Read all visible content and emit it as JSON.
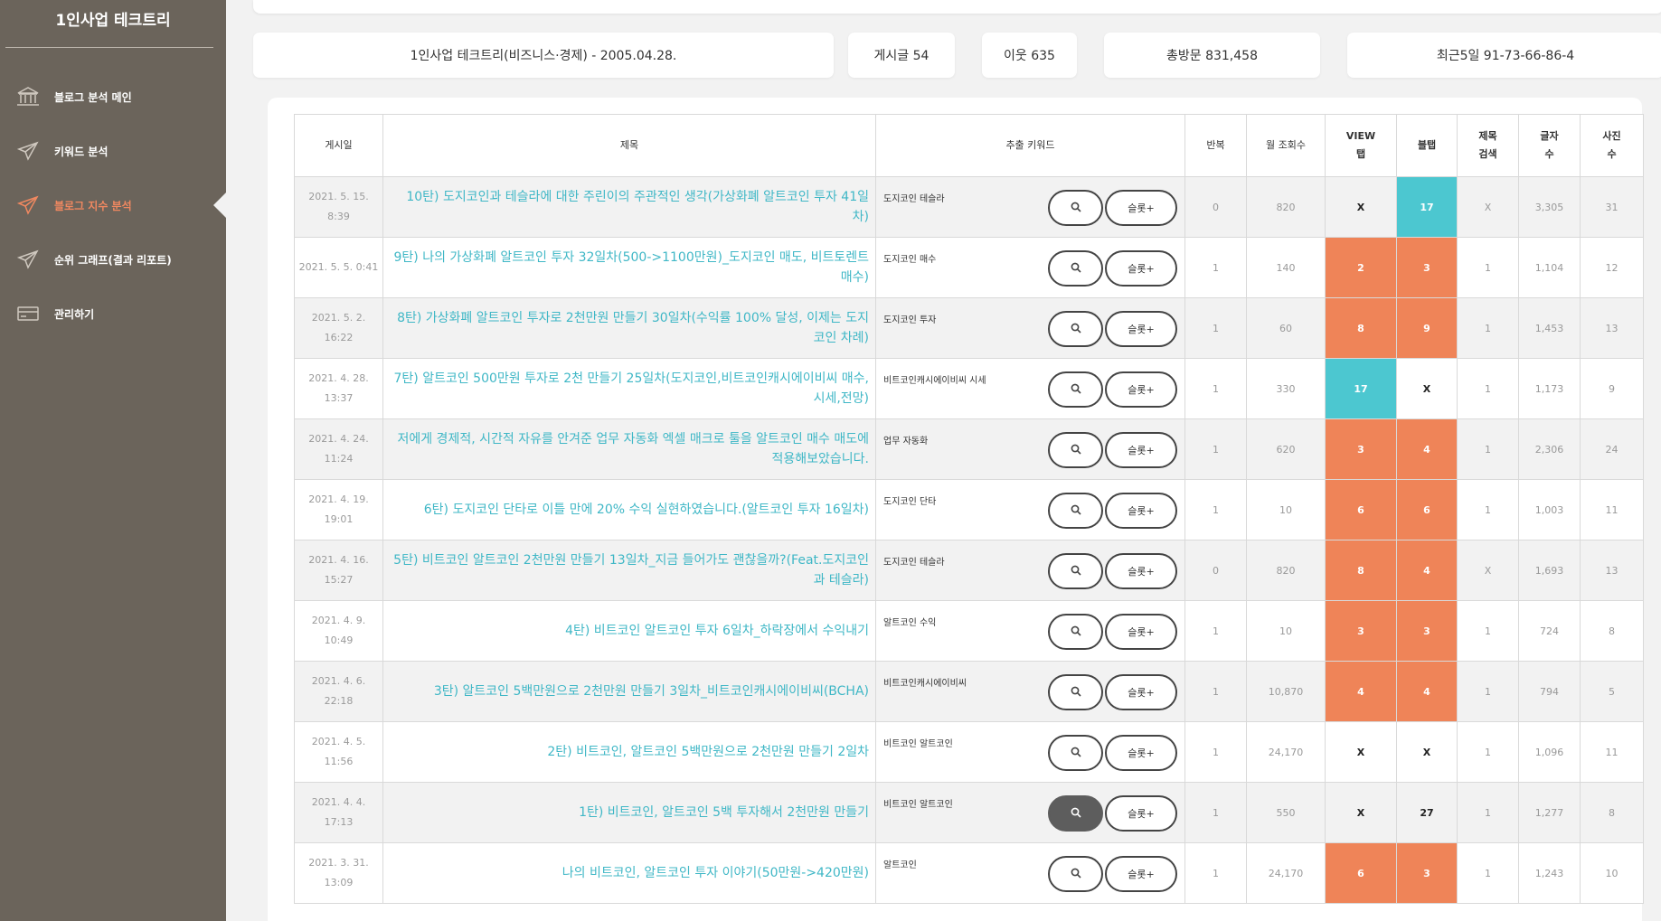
{
  "sidebar": {
    "brand": "1인사업 테크트리",
    "items": [
      {
        "label": "블로그 분석 메인",
        "icon": "bank-icon"
      },
      {
        "label": "키워드 분석",
        "icon": "paper-plane-icon"
      },
      {
        "label": "블로그 지수 분석",
        "icon": "paper-plane-icon"
      },
      {
        "label": "순위 그래프(결과 리포트)",
        "icon": "paper-plane-icon"
      },
      {
        "label": "관리하기",
        "icon": "card-icon"
      }
    ]
  },
  "stats": {
    "blog": "1인사업 테크트리(비즈니스·경제) - 2005.04.28.",
    "posts": "게시글 54",
    "neighbors": "이웃 635",
    "total_visits": "총방문 831,458",
    "recent5": "최근5일 91-73-66-86-4"
  },
  "table": {
    "headers": {
      "date": "게시일",
      "title": "제목",
      "keyword": "추출 키워드",
      "repeat": "반복",
      "monthly": "월 조회수",
      "view_l1": "VIEW",
      "view_l2": "탭",
      "blog": "블탭",
      "title_search_l1": "제목",
      "title_search_l2": "검색",
      "chars_l1": "글자",
      "chars_l2": "수",
      "photos_l1": "사진",
      "photos_l2": "수"
    },
    "slot_label": "슬롯+",
    "rows": [
      {
        "date": "2021. 5. 15. 8:39",
        "title": "10탄) 도지코인과 테슬라에 대한 주린이의 주관적인 생각(가상화폐 알트코인 투자 41일차)",
        "keyword": "도지코인 테슬라",
        "repeat": "0",
        "monthly": "820",
        "view": "X",
        "blog": "17",
        "title_search": "X",
        "chars": "3,305",
        "photos": "31"
      },
      {
        "date": "2021. 5. 5. 0:41",
        "title": "9탄) 나의 가상화폐 알트코인 투자 32일차(500->1100만원)_도지코인 매도, 비트토렌트 매수)",
        "keyword": "도지코인 매수",
        "repeat": "1",
        "monthly": "140",
        "view": "2",
        "blog": "3",
        "title_search": "1",
        "chars": "1,104",
        "photos": "12"
      },
      {
        "date": "2021. 5. 2. 16:22",
        "title": "8탄) 가상화폐 알트코인 투자로 2천만원 만들기 30일차(수익률 100% 달성, 이제는 도지코인 차례)",
        "keyword": "도지코인 투자",
        "repeat": "1",
        "monthly": "60",
        "view": "8",
        "blog": "9",
        "title_search": "1",
        "chars": "1,453",
        "photos": "13"
      },
      {
        "date": "2021. 4. 28. 13:37",
        "title": "7탄) 알트코인 500만원 투자로 2천 만들기 25일차(도지코인,비트코인캐시에이비씨 매수,시세,전망)",
        "keyword": "비트코인캐시에이비씨 시세",
        "repeat": "1",
        "monthly": "330",
        "view": "17",
        "blog": "X",
        "title_search": "1",
        "chars": "1,173",
        "photos": "9"
      },
      {
        "date": "2021. 4. 24. 11:24",
        "title": "저에게 경제적, 시간적 자유를 안겨준 업무 자동화 엑셀 매크로 툴을 알트코인 매수 매도에 적용해보았습니다.",
        "keyword": "업무 자동화",
        "repeat": "1",
        "monthly": "620",
        "view": "3",
        "blog": "4",
        "title_search": "1",
        "chars": "2,306",
        "photos": "24"
      },
      {
        "date": "2021. 4. 19. 19:01",
        "title": "6탄) 도지코인 단타로 이틀 만에 20% 수익 실현하였습니다.(알트코인 투자 16일차)",
        "keyword": "도지코인 단타",
        "repeat": "1",
        "monthly": "10",
        "view": "6",
        "blog": "6",
        "title_search": "1",
        "chars": "1,003",
        "photos": "11"
      },
      {
        "date": "2021. 4. 16. 15:27",
        "title": "5탄) 비트코인 알트코인 2천만원 만들기 13일차_지금 들어가도 괜찮을까?(Feat.도지코인과 테슬라)",
        "keyword": "도지코인 테슬라",
        "repeat": "0",
        "monthly": "820",
        "view": "8",
        "blog": "4",
        "title_search": "X",
        "chars": "1,693",
        "photos": "13"
      },
      {
        "date": "2021. 4. 9. 10:49",
        "title": "4탄) 비트코인 알트코인 투자 6일차_하락장에서 수익내기",
        "keyword": "알트코인 수익",
        "repeat": "1",
        "monthly": "10",
        "view": "3",
        "blog": "3",
        "title_search": "1",
        "chars": "724",
        "photos": "8"
      },
      {
        "date": "2021. 4. 6. 22:18",
        "title": "3탄) 알트코인 5백만원으로 2천만원 만들기 3일차_비트코인캐시에이비씨(BCHA)",
        "keyword": "비트코인캐시에이비씨",
        "repeat": "1",
        "monthly": "10,870",
        "view": "4",
        "blog": "4",
        "title_search": "1",
        "chars": "794",
        "photos": "5"
      },
      {
        "date": "2021. 4. 5. 11:56",
        "title": "2탄) 비트코인, 알트코인 5백만원으로 2천만원 만들기 2일차",
        "keyword": "비트코인 알트코인",
        "repeat": "1",
        "monthly": "24,170",
        "view": "X",
        "blog": "X",
        "title_search": "1",
        "chars": "1,096",
        "photos": "11"
      },
      {
        "date": "2021. 4. 4. 17:13",
        "title": "1탄) 비트코인, 알트코인 5백 투자해서 2천만원 만들기",
        "keyword": "비트코인 알트코인",
        "repeat": "1",
        "monthly": "550",
        "view": "X",
        "blog": "27",
        "title_search": "1",
        "chars": "1,277",
        "photos": "8"
      },
      {
        "date": "2021. 3. 31. 13:09",
        "title": "나의 비트코인, 알트코인 투자 이야기(50만원->420만원)",
        "keyword": "알트코인",
        "repeat": "1",
        "monthly": "24,170",
        "view": "6",
        "blog": "3",
        "title_search": "1",
        "chars": "1,243",
        "photos": "10"
      }
    ]
  },
  "colors": {
    "sidebar": "#6b645b",
    "active": "#f08860",
    "link": "#3fb7c6",
    "orange": "#ef8458",
    "teal": "#4cc7d0"
  }
}
